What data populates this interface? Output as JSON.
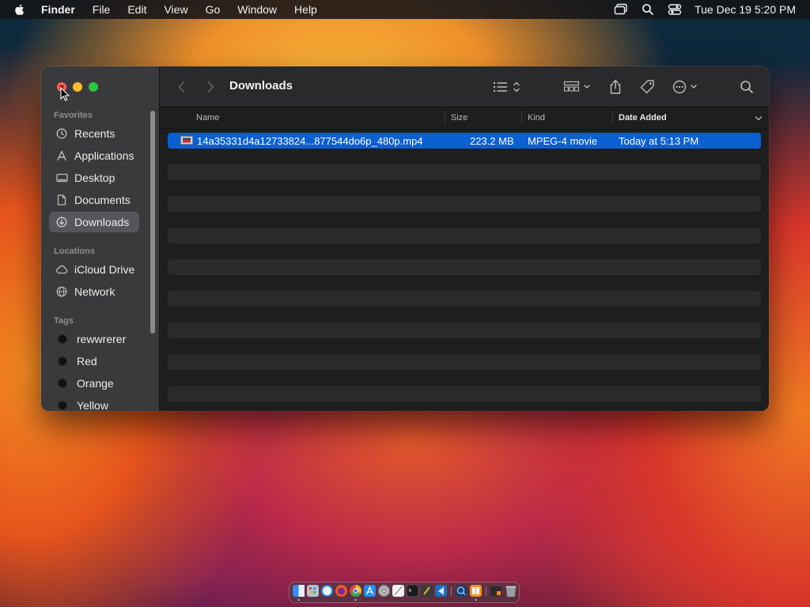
{
  "menubar": {
    "app_name": "Finder",
    "items": [
      "File",
      "Edit",
      "View",
      "Go",
      "Window",
      "Help"
    ],
    "clock": "Tue Dec 19  5:20 PM"
  },
  "window": {
    "title": "Downloads",
    "sidebar": {
      "favorites_label": "Favorites",
      "favorites": [
        {
          "label": "Recents",
          "icon": "clock-icon"
        },
        {
          "label": "Applications",
          "icon": "applications-icon"
        },
        {
          "label": "Desktop",
          "icon": "desktop-icon"
        },
        {
          "label": "Documents",
          "icon": "document-icon"
        },
        {
          "label": "Downloads",
          "icon": "download-icon",
          "selected": true
        }
      ],
      "locations_label": "Locations",
      "locations": [
        {
          "label": "iCloud Drive",
          "icon": "cloud-icon"
        },
        {
          "label": "Network",
          "icon": "network-icon"
        }
      ],
      "tags_label": "Tags",
      "tags": [
        {
          "label": "rewwrerer"
        },
        {
          "label": "Red"
        },
        {
          "label": "Orange"
        },
        {
          "label": "Yellow"
        }
      ]
    },
    "columns": {
      "name": "Name",
      "size": "Size",
      "kind": "Kind",
      "date_added": "Date Added"
    },
    "files": [
      {
        "name": "14a35331d4a12733824...877544do6p_480p.mp4",
        "size": "223.2 MB",
        "kind": "MPEG-4 movie",
        "date_added": "Today at 5:13 PM",
        "selected": true
      }
    ]
  },
  "colors": {
    "selection": "#0a5fd1",
    "close": "#ff5f57",
    "minimize": "#febc2e",
    "zoom": "#28c840"
  }
}
